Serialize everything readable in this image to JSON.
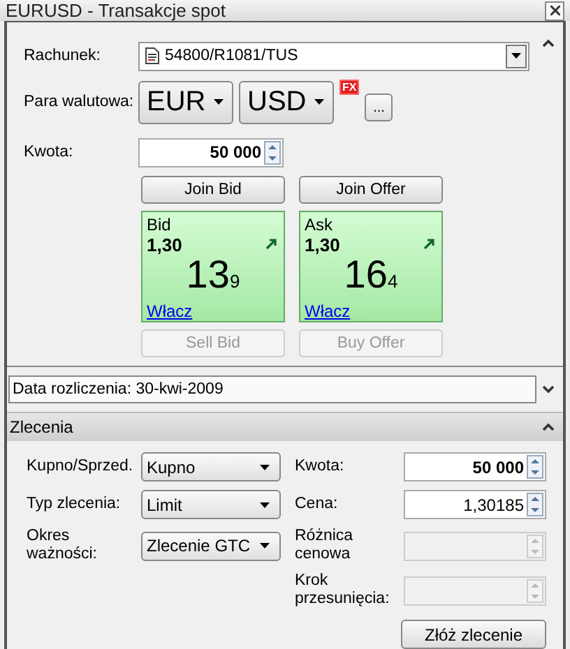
{
  "window": {
    "title": "EURUSD - Transakcje spot"
  },
  "account": {
    "label": "Rachunek:",
    "value": "54800/R1081/TUS"
  },
  "pair": {
    "label": "Para walutowa:",
    "base": "EUR",
    "quote": "USD",
    "badge": "FX",
    "more": "..."
  },
  "amount": {
    "label": "Kwota:",
    "value": "50 000"
  },
  "quotes": [
    {
      "join": "Join Bid",
      "title": "Bid",
      "big": "1,30",
      "pips": "13",
      "fraction": "9",
      "link": "Włacz",
      "action": "Sell Bid",
      "action_disabled": true
    },
    {
      "join": "Join Offer",
      "title": "Ask",
      "big": "1,30",
      "pips": "16",
      "fraction": "4",
      "link": "Włacz",
      "action": "Buy Offer",
      "action_disabled": true
    }
  ],
  "settlement": "Data rozliczenia: 30-kwi-2009",
  "orders": {
    "title": "Zlecenia",
    "expanded": true,
    "rows": [
      {
        "left": {
          "label": "Kupno/Sprzed.",
          "value": "Kupno"
        },
        "right": {
          "label": "Kwota:",
          "value": "50 000",
          "bold": true,
          "disabled": false
        }
      },
      {
        "left": {
          "label": "Typ zlecenia:",
          "value": "Limit"
        },
        "right": {
          "label": "Cena:",
          "value": "1,30185",
          "bold": false,
          "disabled": false
        }
      },
      {
        "left": {
          "label": "Okres ważności:",
          "value": "Zlecenie GTC"
        },
        "right": {
          "label": "Różnica cenowa",
          "disabled": true
        }
      },
      {
        "right": {
          "label": "Krok przesunięcia:",
          "disabled": true
        }
      }
    ],
    "submit": "Złóż zlecenie"
  }
}
